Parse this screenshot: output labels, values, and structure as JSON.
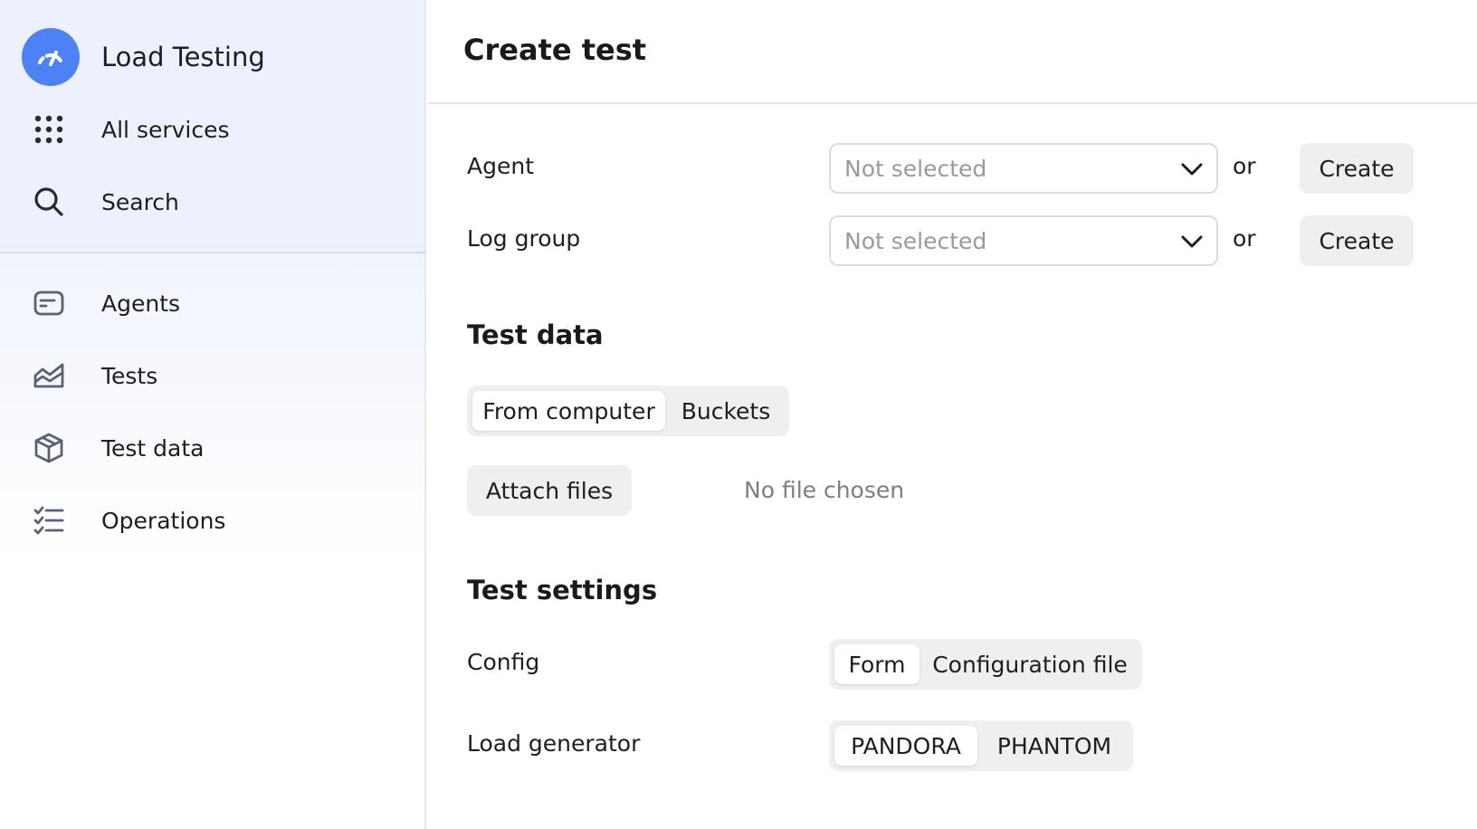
{
  "colors": {
    "accent": "#4d82f7",
    "sidebar_bg": "#edf1fd",
    "button_bg": "#efeff1",
    "placeholder": "#9a9a9e"
  },
  "sidebar": {
    "brand": {
      "label": "Load Testing",
      "icon": "speedometer-icon"
    },
    "top_items": [
      {
        "label": "All services",
        "icon": "grid-dots-icon"
      },
      {
        "label": "Search",
        "icon": "search-icon"
      }
    ],
    "nav_items": [
      {
        "label": "Agents",
        "icon": "server-card-icon"
      },
      {
        "label": "Tests",
        "icon": "area-chart-icon"
      },
      {
        "label": "Test data",
        "icon": "cube-icon"
      },
      {
        "label": "Operations",
        "icon": "checklist-icon"
      }
    ]
  },
  "main": {
    "title": "Create test",
    "agent": {
      "label": "Agent",
      "placeholder": "Not selected",
      "or": "or",
      "create_label": "Create"
    },
    "log_group": {
      "label": "Log group",
      "placeholder": "Not selected",
      "or": "or",
      "create_label": "Create"
    },
    "test_data": {
      "title": "Test data",
      "source_options": [
        "From computer",
        "Buckets"
      ],
      "selected_source": "From computer",
      "attach_label": "Attach files",
      "file_status": "No file chosen"
    },
    "test_settings": {
      "title": "Test settings",
      "config": {
        "label": "Config",
        "options": [
          "Form",
          "Configuration file"
        ],
        "selected": "Form"
      },
      "load_generator": {
        "label": "Load generator",
        "options": [
          "PANDORA",
          "PHANTOM"
        ],
        "selected": "PANDORA"
      }
    }
  }
}
